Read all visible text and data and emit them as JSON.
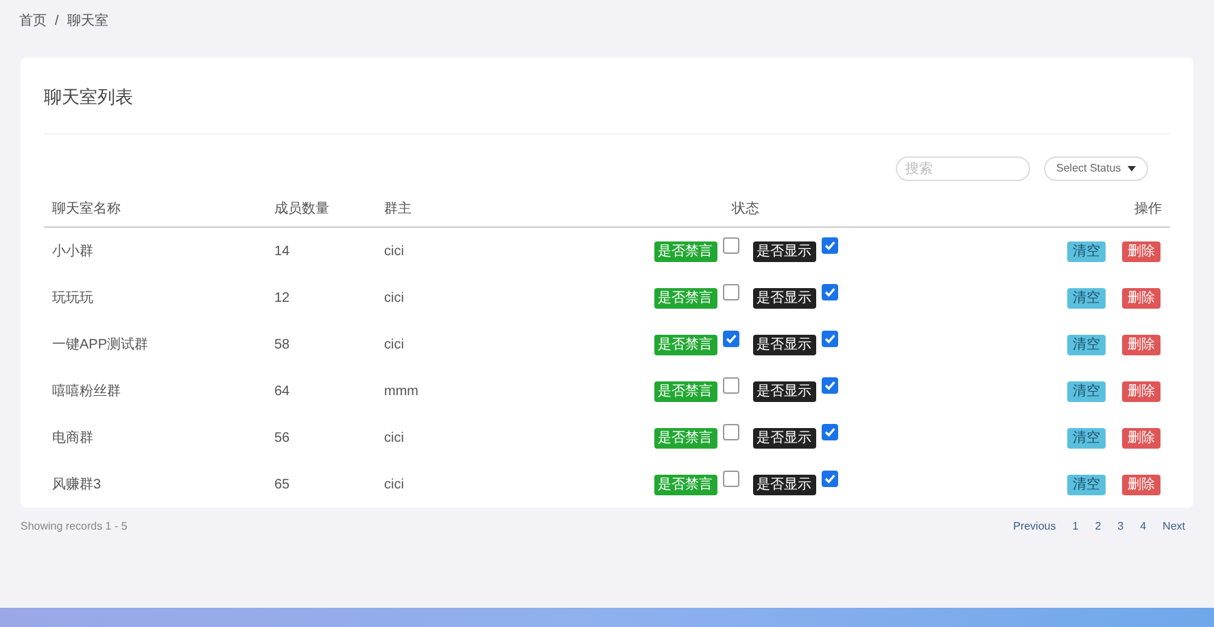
{
  "breadcrumb": {
    "items": [
      "首页",
      "聊天室"
    ],
    "separator": "/"
  },
  "card": {
    "title": "聊天室列表",
    "search": {
      "placeholder": "搜索"
    },
    "status_select": {
      "value": "Select Status"
    }
  },
  "table": {
    "columns": [
      "聊天室名称",
      "成员数量",
      "群主",
      "状态",
      "操作"
    ],
    "rows": [
      {
        "name": "小小群",
        "members": "14",
        "owner": "cici",
        "mute_label": "是否禁言",
        "muted": false,
        "show_label": "是否显示",
        "shown": true,
        "actions": [
          "清空",
          "删除"
        ]
      },
      {
        "name": "玩玩玩",
        "members": "12",
        "owner": "cici",
        "mute_label": "是否禁言",
        "muted": false,
        "show_label": "是否显示",
        "shown": true,
        "actions": [
          "清空",
          "删除"
        ]
      },
      {
        "name": "一键APP测试群",
        "members": "58",
        "owner": "cici",
        "mute_label": "是否禁言",
        "muted": true,
        "show_label": "是否显示",
        "shown": true,
        "actions": [
          "清空",
          "删除"
        ]
      },
      {
        "name": "嘻嘻粉丝群",
        "members": "64",
        "owner": "mmm",
        "mute_label": "是否禁言",
        "muted": false,
        "show_label": "是否显示",
        "shown": true,
        "actions": [
          "清空",
          "删除"
        ]
      },
      {
        "name": "电商群",
        "members": "56",
        "owner": "cici",
        "mute_label": "是否禁言",
        "muted": false,
        "show_label": "是否显示",
        "shown": true,
        "actions": [
          "清空",
          "删除"
        ]
      },
      {
        "name": "风赚群3",
        "members": "65",
        "owner": "cici",
        "mute_label": "是否禁言",
        "muted": false,
        "show_label": "是否显示",
        "shown": true,
        "actions": [
          "清空",
          "删除"
        ]
      }
    ]
  },
  "footer": {
    "records": "Showing records 1 - 5",
    "pagination": [
      "Previous",
      "1",
      "2",
      "3",
      "4",
      "Next"
    ]
  }
}
